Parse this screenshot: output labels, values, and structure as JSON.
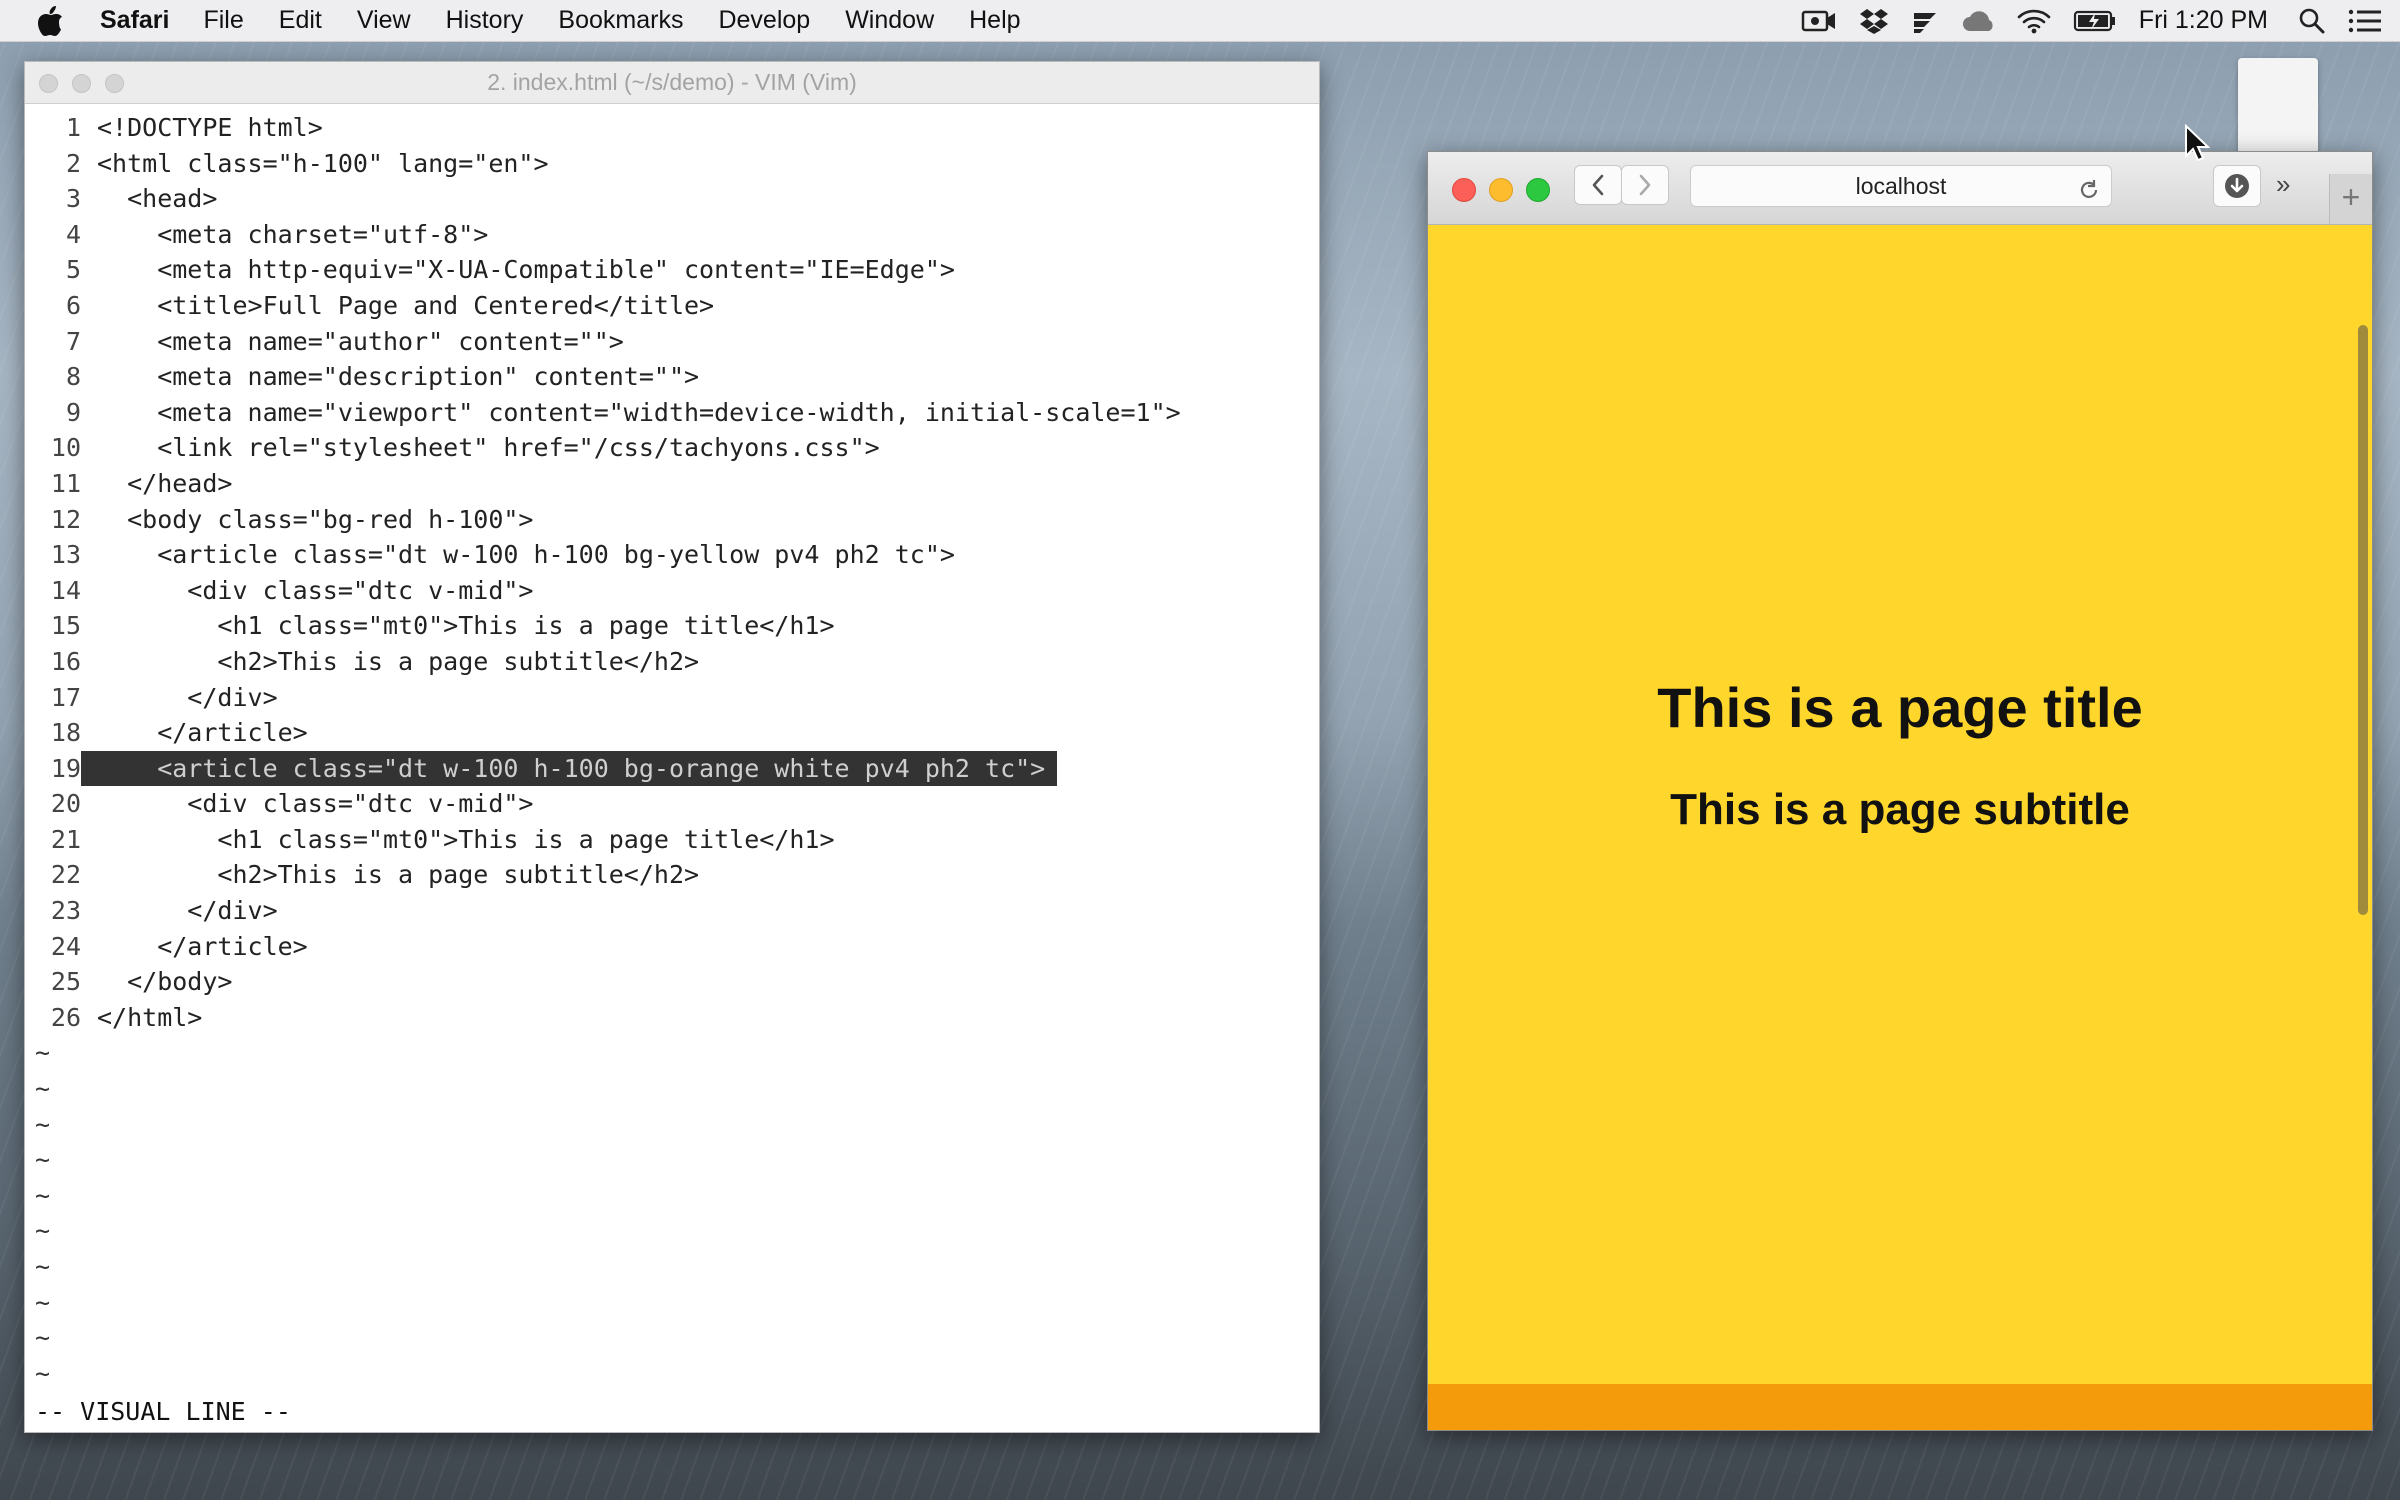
{
  "menubar": {
    "app_name": "Safari",
    "items": [
      "File",
      "Edit",
      "View",
      "History",
      "Bookmarks",
      "Develop",
      "Window",
      "Help"
    ],
    "clock": "Fri 1:20 PM",
    "status_icons": [
      "facetime-camera-icon",
      "dropbox-icon",
      "feed-icon",
      "creative-cloud-icon",
      "wifi-icon",
      "battery-icon",
      "spotlight-search-icon",
      "notification-center-icon"
    ]
  },
  "vim": {
    "title": "2. index.html (~/s/demo) - VIM (Vim)",
    "lines": [
      {
        "n": "1",
        "t": "<!DOCTYPE html>"
      },
      {
        "n": "2",
        "t": "<html class=\"h-100\" lang=\"en\">"
      },
      {
        "n": "3",
        "t": "  <head>"
      },
      {
        "n": "4",
        "t": "    <meta charset=\"utf-8\">"
      },
      {
        "n": "5",
        "t": "    <meta http-equiv=\"X-UA-Compatible\" content=\"IE=Edge\">"
      },
      {
        "n": "6",
        "t": "    <title>Full Page and Centered</title>"
      },
      {
        "n": "7",
        "t": "    <meta name=\"author\" content=\"\">"
      },
      {
        "n": "8",
        "t": "    <meta name=\"description\" content=\"\">"
      },
      {
        "n": "9",
        "t": "    <meta name=\"viewport\" content=\"width=device-width, initial-scale=1\">"
      },
      {
        "n": "10",
        "t": "    <link rel=\"stylesheet\" href=\"/css/tachyons.css\">"
      },
      {
        "n": "11",
        "t": "  </head>"
      },
      {
        "n": "12",
        "t": "  <body class=\"bg-red h-100\">"
      },
      {
        "n": "13",
        "t": "    <article class=\"dt w-100 h-100 bg-yellow pv4 ph2 tc\">"
      },
      {
        "n": "14",
        "t": "      <div class=\"dtc v-mid\">"
      },
      {
        "n": "15",
        "t": "        <h1 class=\"mt0\">This is a page title</h1>"
      },
      {
        "n": "16",
        "t": "        <h2>This is a page subtitle</h2>"
      },
      {
        "n": "17",
        "t": "      </div>"
      },
      {
        "n": "18",
        "t": "    </article>"
      },
      {
        "n": "19",
        "t": "    <article class=\"dt w-100 h-100 bg-orange white pv4 ph2 tc\">"
      },
      {
        "n": "20",
        "t": "      <div class=\"dtc v-mid\">"
      },
      {
        "n": "21",
        "t": "        <h1 class=\"mt0\">This is a page title</h1>"
      },
      {
        "n": "22",
        "t": "        <h2>This is a page subtitle</h2>"
      },
      {
        "n": "23",
        "t": "      </div>"
      },
      {
        "n": "24",
        "t": "    </article>"
      },
      {
        "n": "25",
        "t": "  </body>"
      },
      {
        "n": "26",
        "t": "</html>"
      }
    ],
    "highlighted_line": "19",
    "tilde": "~",
    "mode": "-- VISUAL LINE --"
  },
  "safari": {
    "url": "localhost",
    "page_title": "This is a page title",
    "page_subtitle": "This is a page subtitle",
    "more_label": "»",
    "new_tab_label": "+"
  },
  "colors": {
    "page_yellow": "#ffd62b",
    "page_orange": "#f49b0b",
    "visual_highlight": "#333333"
  }
}
